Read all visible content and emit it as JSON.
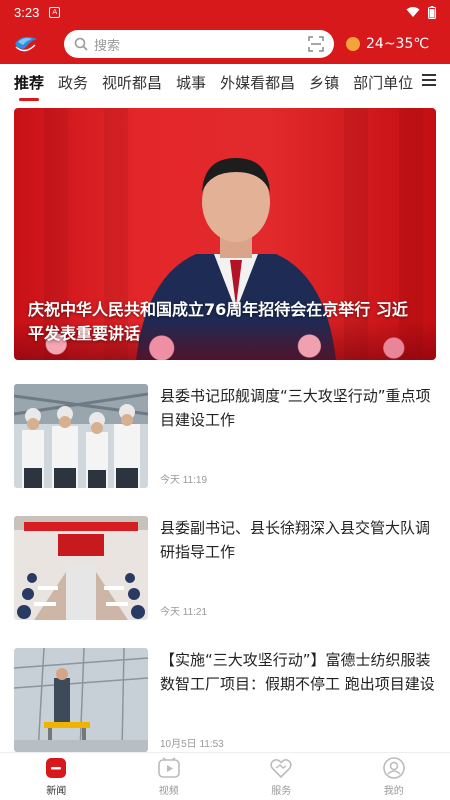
{
  "status": {
    "time": "3:23"
  },
  "search": {
    "placeholder": "搜索"
  },
  "weather": {
    "temp": "24~35℃"
  },
  "tabs": [
    {
      "label": "推荐",
      "active": true
    },
    {
      "label": "政务"
    },
    {
      "label": "视听都昌"
    },
    {
      "label": "城事"
    },
    {
      "label": "外媒看都昌"
    },
    {
      "label": "乡镇"
    },
    {
      "label": "部门单位"
    }
  ],
  "hero": {
    "caption": "庆祝中华人民共和国成立76周年招待会在京举行 习近平发表重要讲话"
  },
  "news": [
    {
      "title": "县委书记邱舰调度“三大攻坚行动”重点项目建设工作",
      "time": "今天 11:19"
    },
    {
      "title": "县委副书记、县长徐翔深入县交管大队调研指导工作",
      "time": "今天 11:21"
    },
    {
      "title": "【实施“三大攻坚行动”】富德士纺织服装数智工厂项目：假期不停工  跑出项目建设加速度",
      "time": "10月5日 11:53"
    }
  ],
  "bottom_nav": [
    {
      "label": "新闻",
      "icon": "news-icon",
      "active": true
    },
    {
      "label": "视频",
      "icon": "video-icon"
    },
    {
      "label": "服务",
      "icon": "service-icon"
    },
    {
      "label": "我的",
      "icon": "profile-icon"
    }
  ],
  "colors": {
    "brand": "#d7191c",
    "text": "#222222",
    "muted": "#999999"
  }
}
